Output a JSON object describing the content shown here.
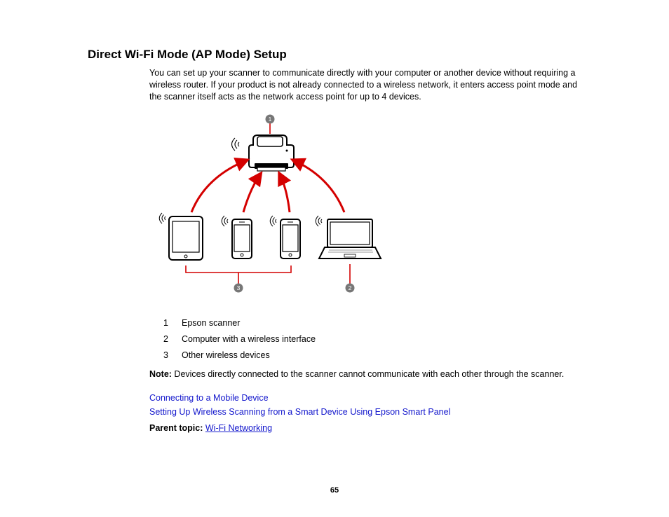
{
  "heading": "Direct Wi-Fi Mode (AP Mode) Setup",
  "intro": "You can set up your scanner to communicate directly with your computer or another device without requiring a wireless router. If your product is not already connected to a wireless network, it enters access point mode and the scanner itself acts as the network access point for up to 4 devices.",
  "diagram": {
    "callout1": "1",
    "callout2": "2",
    "callout3": "3"
  },
  "legend": [
    {
      "num": "1",
      "text": "Epson scanner"
    },
    {
      "num": "2",
      "text": "Computer with a wireless interface"
    },
    {
      "num": "3",
      "text": "Other wireless devices"
    }
  ],
  "note_label": "Note:",
  "note_text": " Devices directly connected to the scanner cannot communicate with each other through the scanner.",
  "links": [
    "Connecting to a Mobile Device",
    "Setting Up Wireless Scanning from a Smart Device Using Epson Smart Panel"
  ],
  "parent_label": "Parent topic: ",
  "parent_link": "Wi-Fi Networking",
  "page_number": "65"
}
